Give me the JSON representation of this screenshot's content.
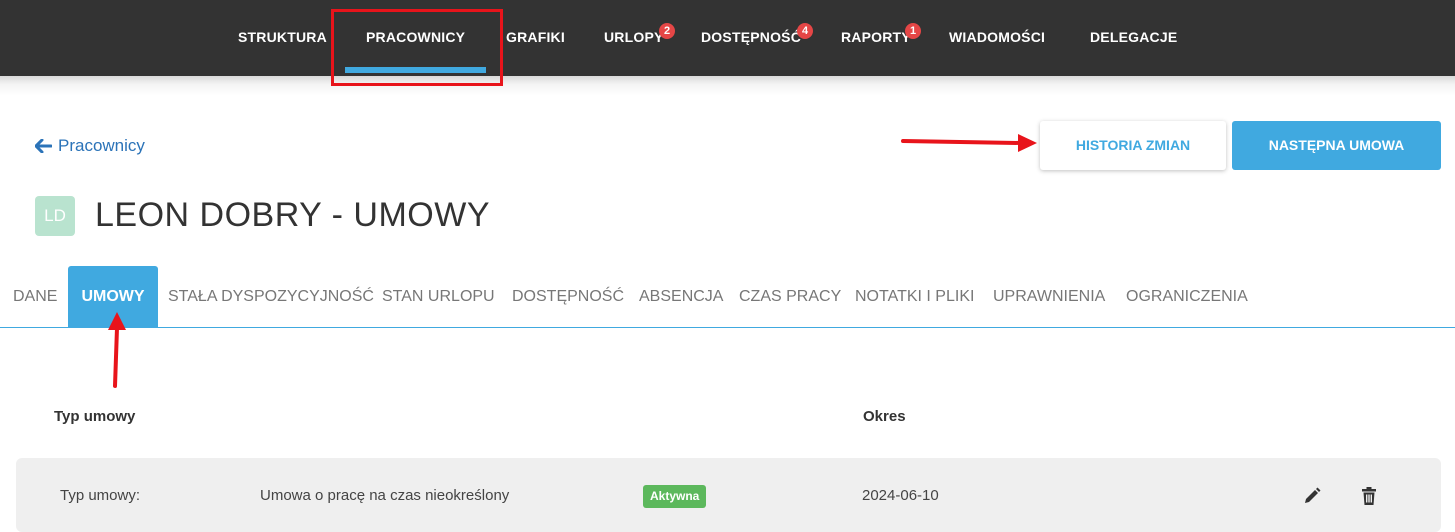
{
  "nav": {
    "items": [
      {
        "label": "STRUKTURA"
      },
      {
        "label": "PRACOWNICY",
        "active": true
      },
      {
        "label": "GRAFIKI"
      },
      {
        "label": "URLOPY",
        "badge": "2"
      },
      {
        "label": "DOSTĘPNOŚĆ",
        "badge": "4"
      },
      {
        "label": "RAPORTY",
        "badge": "1"
      },
      {
        "label": "WIADOMOŚCI"
      },
      {
        "label": "DELEGACJE"
      }
    ]
  },
  "header": {
    "back_label": "Pracownicy",
    "history_button": "HISTORIA ZMIAN",
    "next_button": "NASTĘPNA UMOWA",
    "avatar_initials": "LD",
    "title": "LEON DOBRY - UMOWY"
  },
  "tabs": [
    {
      "label": "DANE"
    },
    {
      "label": "UMOWY",
      "active": true
    },
    {
      "label": "STAŁA DYSPOZYCYJNOŚĆ"
    },
    {
      "label": "STAN URLOPU"
    },
    {
      "label": "DOSTĘPNOŚĆ"
    },
    {
      "label": "ABSENCJA"
    },
    {
      "label": "CZAS PRACY"
    },
    {
      "label": "NOTATKI I PLIKI"
    },
    {
      "label": "UPRAWNIENIA"
    },
    {
      "label": "OGRANICZENIA"
    }
  ],
  "table": {
    "headers": [
      "Typ umowy",
      "Okres"
    ],
    "rows": [
      {
        "type_label": "Typ umowy:",
        "type_value": "Umowa o pracę na czas nieokreślony",
        "status": "Aktywna",
        "period": "2024-06-10",
        "edit_icon": "pencil-icon",
        "delete_icon": "trash-icon"
      }
    ]
  },
  "colors": {
    "accent": "#40a9e0",
    "topbar": "#333333",
    "badge": "#e54646",
    "status_active": "#5cb85c",
    "annotation": "#e8141b"
  }
}
